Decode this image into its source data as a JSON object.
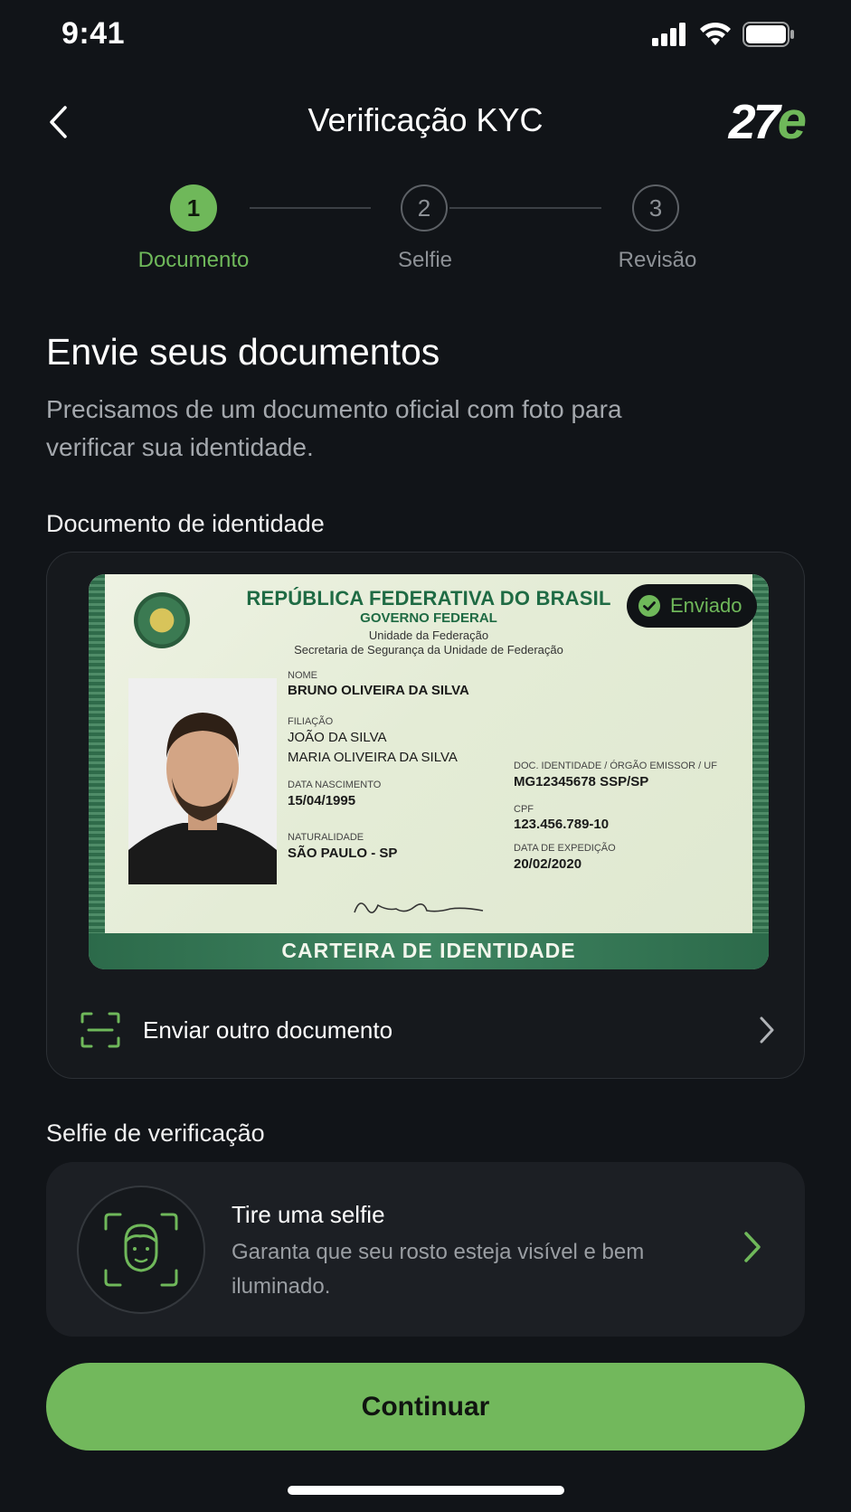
{
  "status_bar": {
    "time": "9:41"
  },
  "header": {
    "title": "Verificação KYC",
    "logo_number": "27",
    "logo_letter": "e"
  },
  "stepper": {
    "steps": [
      {
        "number": "1",
        "label": "Documento"
      },
      {
        "number": "2",
        "label": "Selfie"
      },
      {
        "number": "3",
        "label": "Revisão"
      }
    ],
    "active_step": 1
  },
  "main": {
    "title": "Envie seus documentos",
    "description": "Precisamos de um documento oficial com foto para verificar sua identidade."
  },
  "document_section": {
    "label": "Documento de identidade",
    "status_badge": "Enviado",
    "action_label": "Enviar outro documento",
    "id_card": {
      "header_title": "REPÚBLICA FEDERATIVA DO BRASIL",
      "header_sub1": "GOVERNO FEDERAL",
      "header_sub2": "Unidade da Federação",
      "header_sub3": "Secretaria de Segurança da Unidade de Federação",
      "name_label": "NOME",
      "name": "BRUNO OLIVEIRA DA SILVA",
      "filiation_label": "FILIAÇÃO",
      "father": "JOÃO DA SILVA",
      "mother": "MARIA OLIVEIRA DA SILVA",
      "birth_label": "DATA NASCIMENTO",
      "birth": "15/04/1995",
      "origin_label": "NATURALIDADE",
      "origin": "SÃO PAULO - SP",
      "doc_label": "DOC. IDENTIDADE / ÓRGÃO EMISSOR / UF",
      "doc": "MG12345678 SSP/SP",
      "cpf_label": "CPF",
      "cpf": "123.456.789-10",
      "issue_label": "DATA DE EXPEDIÇÃO",
      "issue": "20/02/2020",
      "footer": "CARTEIRA DE IDENTIDADE"
    }
  },
  "selfie_section": {
    "label": "Selfie de verificação",
    "title": "Tire uma selfie",
    "description": "Garanta que seu rosto esteja visível e bem iluminado."
  },
  "footer": {
    "continue_label": "Continuar"
  },
  "colors": {
    "accent": "#72b85c",
    "background": "#111418",
    "card": "#1c1f24"
  }
}
